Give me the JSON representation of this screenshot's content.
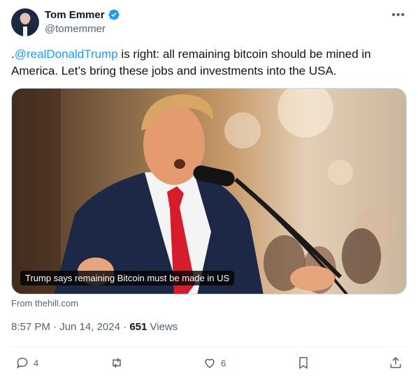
{
  "author": {
    "display_name": "Tom Emmer",
    "handle": "@tomemmer",
    "verified": true
  },
  "tweet": {
    "prefix": ".",
    "mention": "@realDonaldTrump",
    "text_after_mention": " is right: all remaining bitcoin should be mined in America. Let’s bring these jobs and investments into the USA."
  },
  "media": {
    "caption": "Trump says remaining Bitcoin must be made in US",
    "source": "From thehill.com"
  },
  "meta": {
    "time": "8:57 PM",
    "date": "Jun 14, 2024",
    "views_count": "651",
    "views_label": "Views"
  },
  "actions": {
    "replies": "4",
    "reposts": "",
    "likes": "6"
  },
  "colors": {
    "accent": "#1d9bf0",
    "text": "#0f1419",
    "secondary": "#536471"
  },
  "icons": [
    "verified-badge-icon",
    "more-icon",
    "reply-icon",
    "repost-icon",
    "like-icon",
    "bookmark-icon",
    "share-icon"
  ]
}
